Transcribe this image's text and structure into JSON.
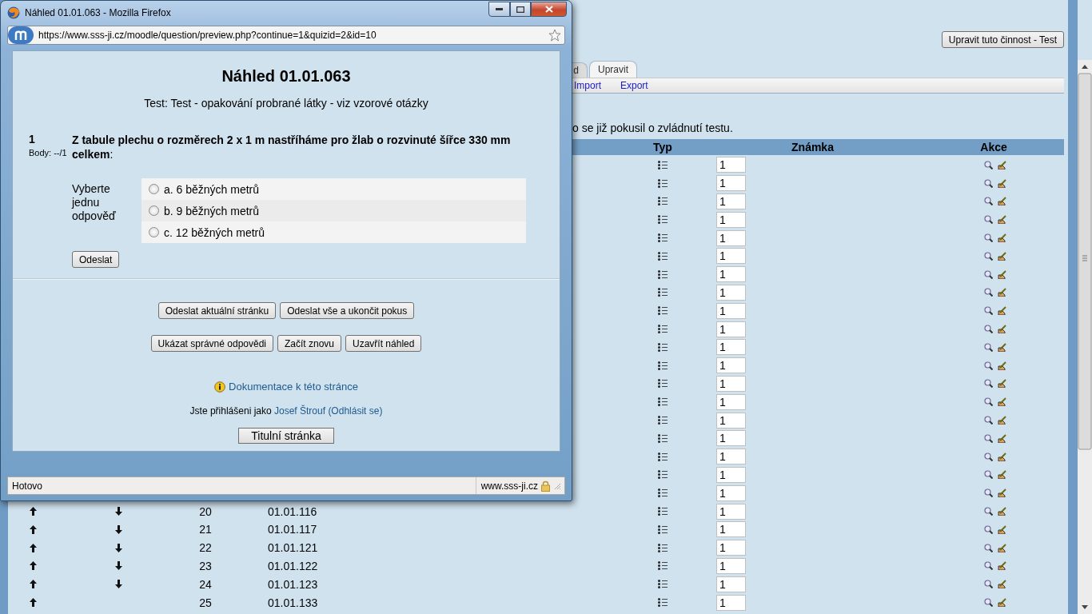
{
  "page": {
    "edit_button": "Upravit tuto činnost - Test",
    "tabs": [
      {
        "label": "d",
        "selected": false
      },
      {
        "label": "Upravit",
        "selected": true
      }
    ],
    "subtabs": [
      "Import",
      "Export"
    ],
    "notice": "o se již pokusil o zvládnutí testu.",
    "columns": [
      "Typ",
      "Známka",
      "Akce"
    ],
    "rows": [
      {
        "grade": "1"
      },
      {
        "grade": "1"
      },
      {
        "grade": "1"
      },
      {
        "grade": "1"
      },
      {
        "grade": "1"
      },
      {
        "grade": "1"
      },
      {
        "grade": "1"
      },
      {
        "grade": "1"
      },
      {
        "grade": "1"
      },
      {
        "grade": "1"
      },
      {
        "grade": "1"
      },
      {
        "grade": "1"
      },
      {
        "grade": "1"
      },
      {
        "grade": "1"
      },
      {
        "grade": "1"
      },
      {
        "grade": "1"
      },
      {
        "grade": "1"
      },
      {
        "grade": "1"
      },
      {
        "grade": "1"
      },
      {
        "up": true,
        "down": true,
        "number": "20",
        "name": "01.01.116",
        "grade": "1"
      },
      {
        "up": true,
        "down": true,
        "number": "21",
        "name": "01.01.117",
        "grade": "1"
      },
      {
        "up": true,
        "down": true,
        "number": "22",
        "name": "01.01.121",
        "grade": "1"
      },
      {
        "up": true,
        "down": true,
        "number": "23",
        "name": "01.01.122",
        "grade": "1"
      },
      {
        "up": true,
        "down": true,
        "number": "24",
        "name": "01.01.123",
        "grade": "1"
      },
      {
        "up": true,
        "down": false,
        "number": "25",
        "name": "01.01.133",
        "grade": "1"
      }
    ]
  },
  "popup": {
    "title": "Náhled 01.01.063 - Mozilla Firefox",
    "url": "https://www.sss-ji.cz/moodle/question/preview.php?continue=1&quizid=2&id=10",
    "heading": "Náhled 01.01.063",
    "subtitle": "Test: Test - opakování probrané látky - viz vzorové otázky",
    "question": {
      "number": "1",
      "points": "Body: --/1",
      "text": "**Z tabule plechu o rozměrech 2 x 1 m nastříháme pro žlab o rozvinuté šířce 330 mm celkem**:",
      "prompt": "Vyberte jednu odpověď",
      "options": [
        {
          "label": "a. 6 běžných metrů",
          "selected": false
        },
        {
          "label": "b. 9 běžných metrů",
          "selected": false
        },
        {
          "label": "c. 12 běžných metrů",
          "selected": false
        }
      ],
      "submit": "Odeslat"
    },
    "action_rows": [
      [
        "Odeslat aktuální stránku",
        "Odeslat vše a ukončit pokus"
      ],
      [
        "Ukázat správné odpovědi",
        "Začít znovu",
        "Uzavřít náhled"
      ]
    ],
    "doc_link": "Dokumentace k této stránce",
    "login": {
      "prefix": "Jste přihlášeni jako",
      "user": "Josef Štrouf",
      "logout": "(Odhlásit se)"
    },
    "home_button": "Titulní stránka",
    "status": "Hotovo",
    "status_site": "www.sss-ji.cz"
  }
}
